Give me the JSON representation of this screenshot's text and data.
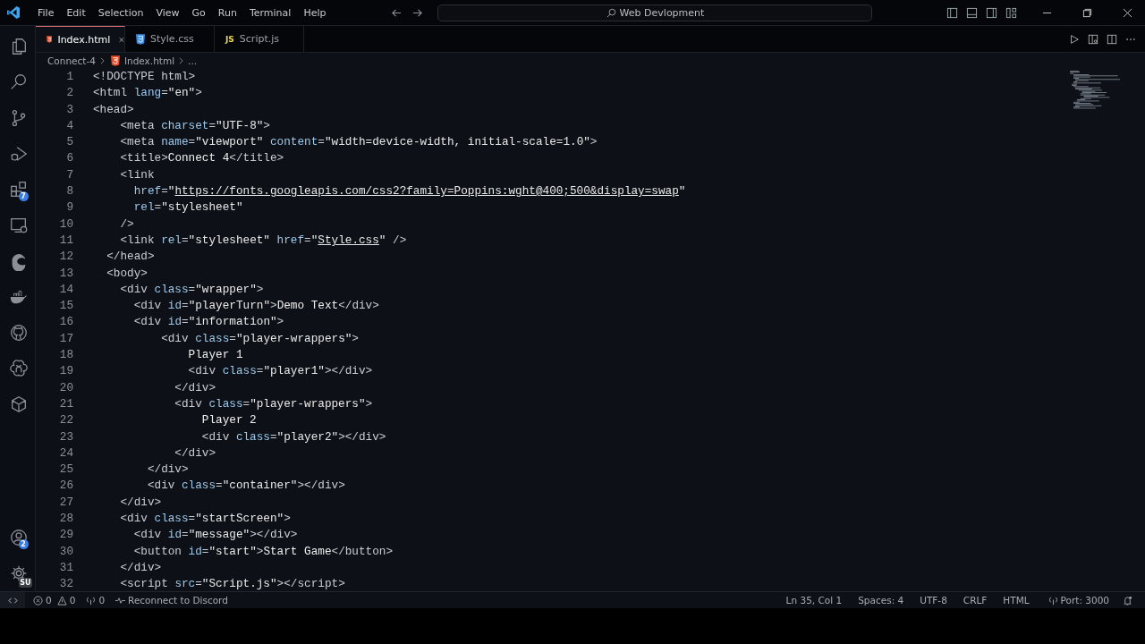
{
  "menu": [
    "File",
    "Edit",
    "Selection",
    "View",
    "Go",
    "Run",
    "Terminal",
    "Help"
  ],
  "search": {
    "value": "Web Devlopment"
  },
  "activity_bar": [
    {
      "kind": "files",
      "selected": false
    },
    {
      "kind": "search",
      "selected": false
    },
    {
      "kind": "source-control",
      "selected": false
    },
    {
      "kind": "run",
      "selected": false
    },
    {
      "kind": "extensions",
      "selected": false,
      "badge": "7"
    },
    {
      "kind": "remote",
      "selected": false
    },
    {
      "kind": "edge",
      "selected": false
    },
    {
      "kind": "docker",
      "selected": false
    },
    {
      "kind": "github",
      "selected": false
    },
    {
      "kind": "knot",
      "selected": false
    },
    {
      "kind": "cube",
      "selected": false
    }
  ],
  "activity_bottom": [
    {
      "kind": "account",
      "badge": "2"
    },
    {
      "kind": "settings",
      "badge": "SU"
    }
  ],
  "tabs": [
    {
      "label": "Index.html",
      "kind": "html",
      "selected": true
    },
    {
      "label": "Style.css",
      "kind": "css",
      "selected": false
    },
    {
      "label": "Script.js",
      "kind": "js",
      "icon_label": "JS",
      "selected": false
    }
  ],
  "breadcrumb": {
    "folder": "Connect-4",
    "file": "Index.html",
    "more": "..."
  },
  "code": [
    {
      "n": "1",
      "t": [
        {
          "kind": "tag",
          "text": "<!DOCTYPE html>"
        }
      ]
    },
    {
      "n": "2",
      "t": [
        {
          "kind": "tag",
          "text": "<html "
        },
        {
          "kind": "attr",
          "text": "lang"
        },
        {
          "kind": "tag",
          "text": "="
        },
        {
          "kind": "string",
          "text": "\"en\""
        },
        {
          "kind": "tag",
          "text": ">"
        }
      ]
    },
    {
      "n": "3",
      "t": [
        {
          "kind": "tag",
          "text": "<head>"
        }
      ]
    },
    {
      "n": "4",
      "t": [
        {
          "kind": "tag",
          "text": "    <meta "
        },
        {
          "kind": "attr",
          "text": "charset"
        },
        {
          "kind": "tag",
          "text": "="
        },
        {
          "kind": "string",
          "text": "\"UTF-8\""
        },
        {
          "kind": "tag",
          "text": ">"
        }
      ]
    },
    {
      "n": "5",
      "t": [
        {
          "kind": "tag",
          "text": "    <meta "
        },
        {
          "kind": "attr",
          "text": "name"
        },
        {
          "kind": "tag",
          "text": "="
        },
        {
          "kind": "string",
          "text": "\"viewport\" "
        },
        {
          "kind": "attr",
          "text": "content"
        },
        {
          "kind": "tag",
          "text": "="
        },
        {
          "kind": "string",
          "text": "\"width=device-width, initial-scale=1.0\""
        },
        {
          "kind": "tag",
          "text": ">"
        }
      ]
    },
    {
      "n": "6",
      "t": [
        {
          "kind": "tag",
          "text": "    <title>"
        },
        {
          "kind": "text",
          "text": "Connect 4"
        },
        {
          "kind": "tag",
          "text": "</title>"
        }
      ]
    },
    {
      "n": "7",
      "t": [
        {
          "kind": "tag",
          "text": "    <link"
        }
      ]
    },
    {
      "n": "8",
      "t": [
        {
          "kind": "attr",
          "text": "      href"
        },
        {
          "kind": "tag",
          "text": "="
        },
        {
          "kind": "string",
          "text": "\""
        },
        {
          "kind": "link",
          "text": "https://fonts.googleapis.com/css2?family=Poppins:wght@400;500&display=swap"
        },
        {
          "kind": "string",
          "text": "\""
        }
      ]
    },
    {
      "n": "9",
      "t": [
        {
          "kind": "attr",
          "text": "      rel"
        },
        {
          "kind": "tag",
          "text": "="
        },
        {
          "kind": "string",
          "text": "\"stylesheet\""
        }
      ]
    },
    {
      "n": "10",
      "t": [
        {
          "kind": "tag",
          "text": "    />"
        }
      ]
    },
    {
      "n": "11",
      "t": [
        {
          "kind": "tag",
          "text": "    <link "
        },
        {
          "kind": "attr",
          "text": "rel"
        },
        {
          "kind": "tag",
          "text": "="
        },
        {
          "kind": "string",
          "text": "\"stylesheet\" "
        },
        {
          "kind": "attr",
          "text": "href"
        },
        {
          "kind": "tag",
          "text": "="
        },
        {
          "kind": "string",
          "text": "\""
        },
        {
          "kind": "link",
          "text": "Style.css"
        },
        {
          "kind": "string",
          "text": "\""
        },
        {
          "kind": "tag",
          "text": " />"
        }
      ]
    },
    {
      "n": "12",
      "t": [
        {
          "kind": "tag",
          "text": "  </head>"
        }
      ]
    },
    {
      "n": "13",
      "t": [
        {
          "kind": "tag",
          "text": "  <body>"
        }
      ]
    },
    {
      "n": "14",
      "t": [
        {
          "kind": "tag",
          "text": "    <div "
        },
        {
          "kind": "attr",
          "text": "class"
        },
        {
          "kind": "tag",
          "text": "="
        },
        {
          "kind": "string",
          "text": "\"wrapper\""
        },
        {
          "kind": "tag",
          "text": ">"
        }
      ]
    },
    {
      "n": "15",
      "t": [
        {
          "kind": "tag",
          "text": "      <div "
        },
        {
          "kind": "attr",
          "text": "id"
        },
        {
          "kind": "tag",
          "text": "="
        },
        {
          "kind": "string",
          "text": "\"playerTurn\""
        },
        {
          "kind": "tag",
          "text": ">"
        },
        {
          "kind": "text",
          "text": "Demo Text"
        },
        {
          "kind": "tag",
          "text": "</div>"
        }
      ]
    },
    {
      "n": "16",
      "t": [
        {
          "kind": "tag",
          "text": "      <div "
        },
        {
          "kind": "attr",
          "text": "id"
        },
        {
          "kind": "tag",
          "text": "="
        },
        {
          "kind": "string",
          "text": "\"information\""
        },
        {
          "kind": "tag",
          "text": ">"
        }
      ]
    },
    {
      "n": "17",
      "t": [
        {
          "kind": "tag",
          "text": "          <div "
        },
        {
          "kind": "attr",
          "text": "class"
        },
        {
          "kind": "tag",
          "text": "="
        },
        {
          "kind": "string",
          "text": "\"player-wrappers\""
        },
        {
          "kind": "tag",
          "text": ">"
        }
      ]
    },
    {
      "n": "18",
      "t": [
        {
          "kind": "text",
          "text": "              Player 1"
        }
      ]
    },
    {
      "n": "19",
      "t": [
        {
          "kind": "tag",
          "text": "              <div "
        },
        {
          "kind": "attr",
          "text": "class"
        },
        {
          "kind": "tag",
          "text": "="
        },
        {
          "kind": "string",
          "text": "\"player1\""
        },
        {
          "kind": "tag",
          "text": "></div>"
        }
      ]
    },
    {
      "n": "20",
      "t": [
        {
          "kind": "tag",
          "text": "            </div>"
        }
      ]
    },
    {
      "n": "21",
      "t": [
        {
          "kind": "tag",
          "text": "            <div "
        },
        {
          "kind": "attr",
          "text": "class"
        },
        {
          "kind": "tag",
          "text": "="
        },
        {
          "kind": "string",
          "text": "\"player-wrappers\""
        },
        {
          "kind": "tag",
          "text": ">"
        }
      ]
    },
    {
      "n": "22",
      "t": [
        {
          "kind": "text",
          "text": "                Player 2"
        }
      ]
    },
    {
      "n": "23",
      "t": [
        {
          "kind": "tag",
          "text": "                <div "
        },
        {
          "kind": "attr",
          "text": "class"
        },
        {
          "kind": "tag",
          "text": "="
        },
        {
          "kind": "string",
          "text": "\"player2\""
        },
        {
          "kind": "tag",
          "text": "></div>"
        }
      ]
    },
    {
      "n": "24",
      "t": [
        {
          "kind": "tag",
          "text": "            </div>"
        }
      ]
    },
    {
      "n": "25",
      "t": [
        {
          "kind": "tag",
          "text": "        </div>"
        }
      ]
    },
    {
      "n": "26",
      "t": [
        {
          "kind": "tag",
          "text": "        <div "
        },
        {
          "kind": "attr",
          "text": "class"
        },
        {
          "kind": "tag",
          "text": "="
        },
        {
          "kind": "string",
          "text": "\"container\""
        },
        {
          "kind": "tag",
          "text": "></div>"
        }
      ]
    },
    {
      "n": "27",
      "t": [
        {
          "kind": "tag",
          "text": "    </div>"
        }
      ]
    },
    {
      "n": "28",
      "t": [
        {
          "kind": "tag",
          "text": "    <div "
        },
        {
          "kind": "attr",
          "text": "class"
        },
        {
          "kind": "tag",
          "text": "="
        },
        {
          "kind": "string",
          "text": "\"startScreen\""
        },
        {
          "kind": "tag",
          "text": ">"
        }
      ]
    },
    {
      "n": "29",
      "t": [
        {
          "kind": "tag",
          "text": "      <div "
        },
        {
          "kind": "attr",
          "text": "id"
        },
        {
          "kind": "tag",
          "text": "="
        },
        {
          "kind": "string",
          "text": "\"message\""
        },
        {
          "kind": "tag",
          "text": "></div>"
        }
      ]
    },
    {
      "n": "30",
      "t": [
        {
          "kind": "tag",
          "text": "      <button "
        },
        {
          "kind": "attr",
          "text": "id"
        },
        {
          "kind": "tag",
          "text": "="
        },
        {
          "kind": "string",
          "text": "\"start\""
        },
        {
          "kind": "tag",
          "text": ">"
        },
        {
          "kind": "text",
          "text": "Start Game"
        },
        {
          "kind": "tag",
          "text": "</button>"
        }
      ]
    },
    {
      "n": "31",
      "t": [
        {
          "kind": "tag",
          "text": "    </div>"
        }
      ]
    },
    {
      "n": "32",
      "t": [
        {
          "kind": "tag",
          "text": "    <script "
        },
        {
          "kind": "attr",
          "text": "src"
        },
        {
          "kind": "tag",
          "text": "="
        },
        {
          "kind": "string",
          "text": "\"Script.js\""
        },
        {
          "kind": "tag",
          "text": "></script>"
        }
      ]
    }
  ],
  "status_left": {
    "errors": "0",
    "warnings": "0",
    "ports": "0",
    "discord": "Reconnect to Discord"
  },
  "status_right": [
    "Ln 35, Col 1",
    "Spaces: 4",
    "UTF-8",
    "CRLF",
    "HTML"
  ],
  "port": "Port: 3000"
}
